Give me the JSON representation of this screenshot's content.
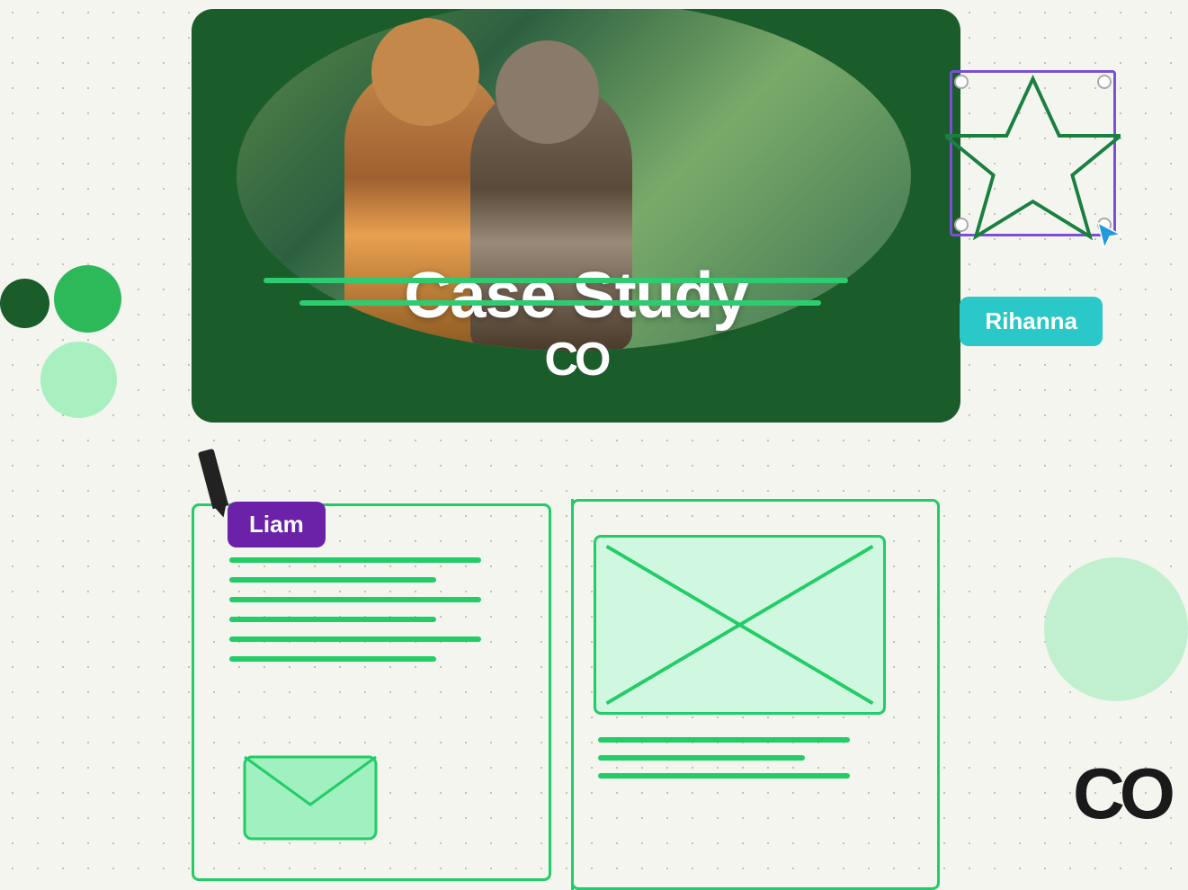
{
  "page": {
    "background_color": "#f5f5f0"
  },
  "top_card": {
    "title": "Case Study",
    "logo": "CO",
    "background_color": "#1a5c2a"
  },
  "star_element": {
    "border_color": "#7a4fd6"
  },
  "rihanna_tag": {
    "label": "Rihanna",
    "background": "#2ac8c8"
  },
  "liam_tag": {
    "label": "Liam",
    "background": "#6b21a8"
  },
  "co_logo_bottom": {
    "text": "CO"
  },
  "decorative": {
    "circle_dark": "#1a5c2a",
    "circle_medium": "#2db85a",
    "circle_light": "#a8f0c0"
  }
}
